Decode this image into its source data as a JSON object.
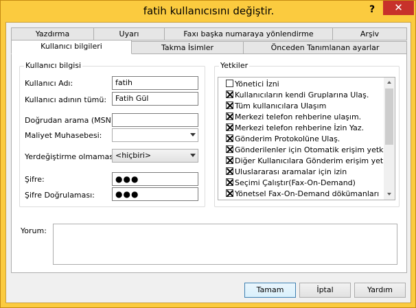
{
  "window": {
    "title": "fatih kullanıcısını değiştir.",
    "help_glyph": "?",
    "close_glyph": "✕"
  },
  "tabs": {
    "row1": [
      "Yazdırma",
      "Uyarı",
      "Faxı başka numaraya yönlendirme",
      "Arşiv"
    ],
    "row2": [
      "Kullanıcı bilgileri",
      "Takma İsimler",
      "Önceden Tanımlanan ayarlar"
    ],
    "active": "Kullanıcı bilgileri"
  },
  "user_info": {
    "group_title": "Kullanıcı bilgisi",
    "username_label": "Kullanıcı Adı:",
    "username_value": "fatih",
    "fullname_label": "Kullanıcı adının tümü:",
    "fullname_value": "Fatih Gül",
    "direct_dial_label": "Doğrudan arama (MSN):",
    "direct_dial_value": "",
    "cost_center_label": "Maliyet Muhasebesi:",
    "cost_center_value": "",
    "substitute_label": "Yerdeğiştirme olmaması:",
    "substitute_value": "<hiçbiri>",
    "password_label": "Şifre:",
    "password_value": "●●●",
    "password_confirm_label": "Şifre Doğrulaması:",
    "password_confirm_value": "●●●"
  },
  "permissions": {
    "group_title": "Yetkiler",
    "items": [
      {
        "label": "Yönetici İzni",
        "checked": false
      },
      {
        "label": "Kullanıcıların kendi Gruplarına Ulaş.",
        "checked": true
      },
      {
        "label": "Tüm kullanıcılara Ulaşım",
        "checked": true
      },
      {
        "label": "Merkezi telefon rehberine ulaşım.",
        "checked": true
      },
      {
        "label": "Merkezi telefon rehberine İzin Yaz.",
        "checked": true
      },
      {
        "label": "Gönderim Protokolüne Ulaş.",
        "checked": true
      },
      {
        "label": "Gönderilenler için Otomatik erişim yetkisi",
        "checked": true
      },
      {
        "label": "Diğer Kullanıcılara Gönderim erişim yetkisi.",
        "checked": true
      },
      {
        "label": "Uluslararası aramalar için izin",
        "checked": true
      },
      {
        "label": "Seçimi Çalıştır(Fax-On-Demand)",
        "checked": true
      },
      {
        "label": "Yönetsel Fax-On-Demand dökümanları",
        "checked": true
      }
    ]
  },
  "comment": {
    "label": "Yorum:",
    "value": ""
  },
  "buttons": {
    "ok": "Tamam",
    "cancel": "İptal",
    "help": "Yardım"
  },
  "colors": {
    "title_bar": "#fbcb3f",
    "close_button": "#c7312a",
    "default_button_border": "#3c7fb1"
  }
}
